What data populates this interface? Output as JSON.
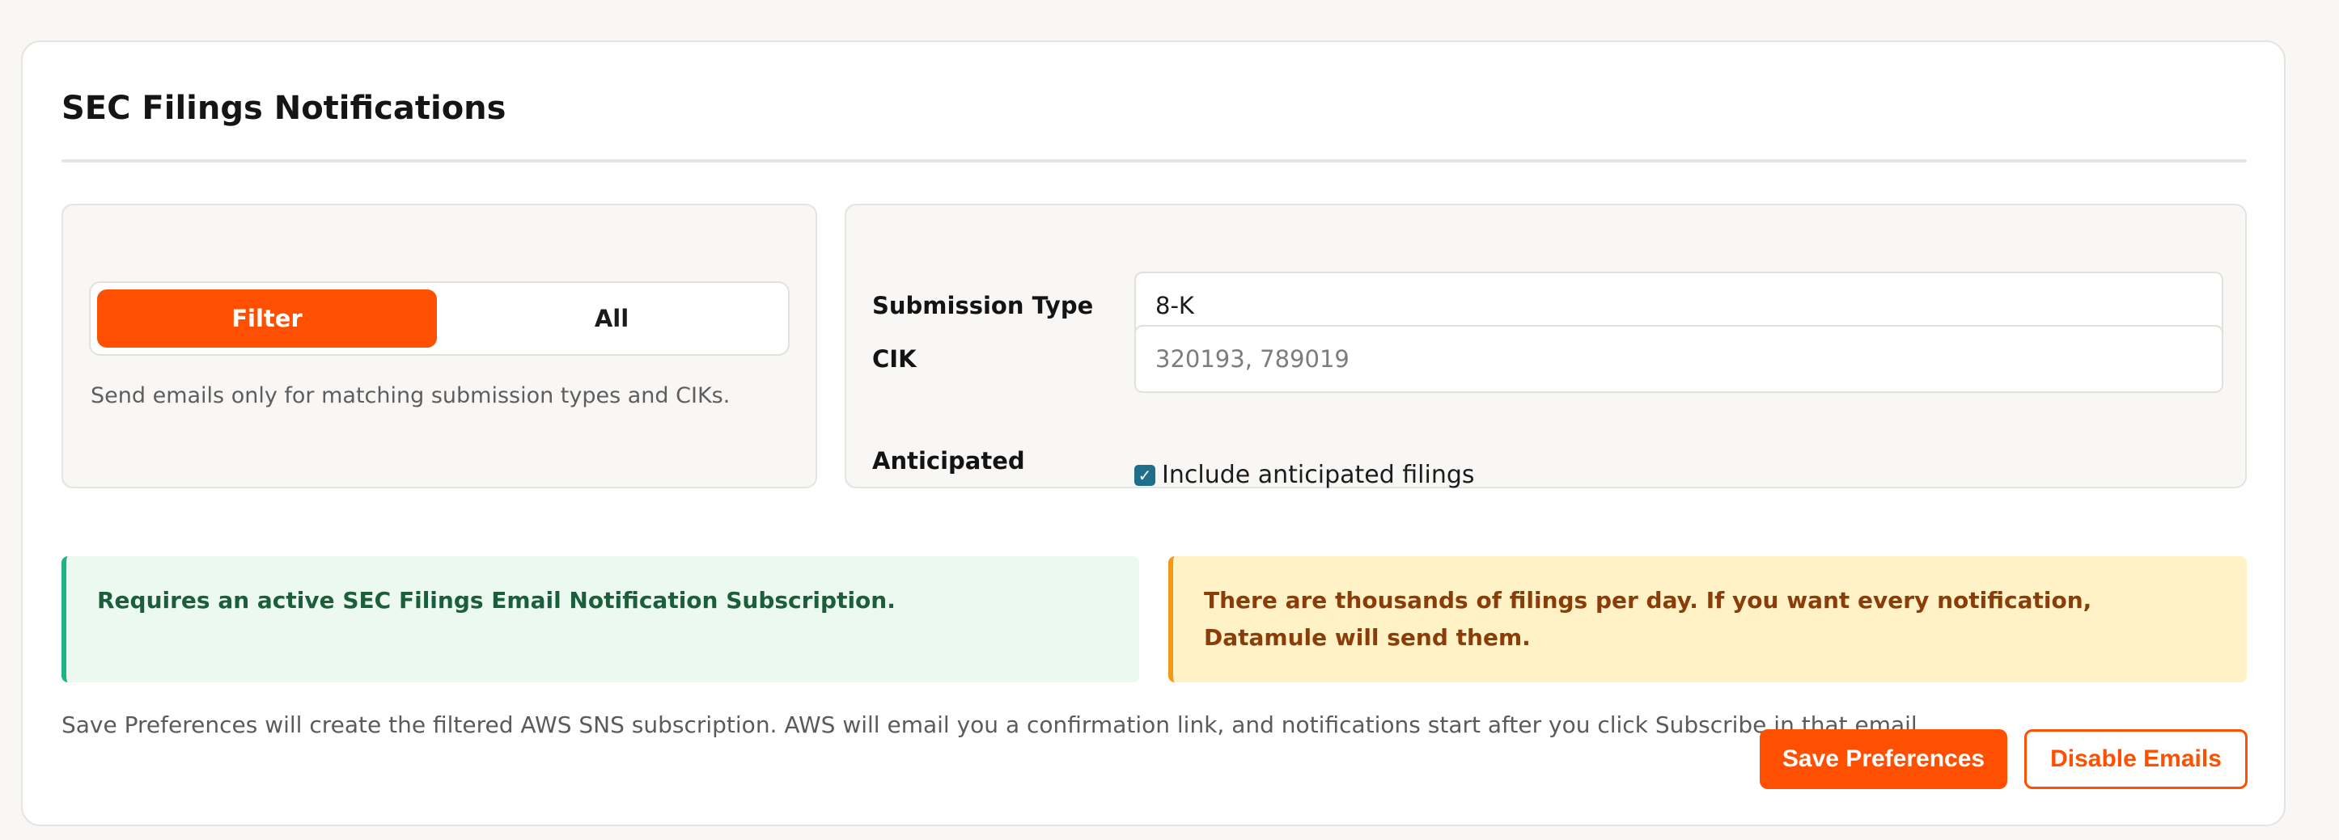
{
  "card": {
    "title": "SEC Filings Notifications"
  },
  "mode": {
    "selected": "Filter",
    "options": [
      "Filter",
      "All"
    ],
    "help_text": "Send emails only for matching submission types and CIKs."
  },
  "fields": {
    "submission_type": {
      "label": "Submission Type",
      "value": "8-K"
    },
    "cik": {
      "label": "CIK",
      "value": "",
      "placeholder": "320193, 789019"
    },
    "anticipated": {
      "label": "Anticipated",
      "checkbox_label": "Include anticipated filings",
      "checked": true
    }
  },
  "notices": {
    "subscription": "Requires an active SEC Filings Email Notification Subscription.",
    "volume": "There are thousands of filings per day. If you want every notification, Datamule will send them."
  },
  "footnote": "Save Preferences will create the filtered AWS SNS subscription. AWS will email you a confirmation link, and notifications start after you click Subscribe in that email.",
  "actions": {
    "save_label": "Save Preferences",
    "disable_label": "Disable Emails"
  },
  "colors": {
    "accent": "#ff4f00",
    "success_border": "#1db386",
    "warning_border": "#f29a17",
    "checkbox": "#1f6f8b"
  },
  "icons": {
    "checkbox_check": "checkmark-icon"
  }
}
